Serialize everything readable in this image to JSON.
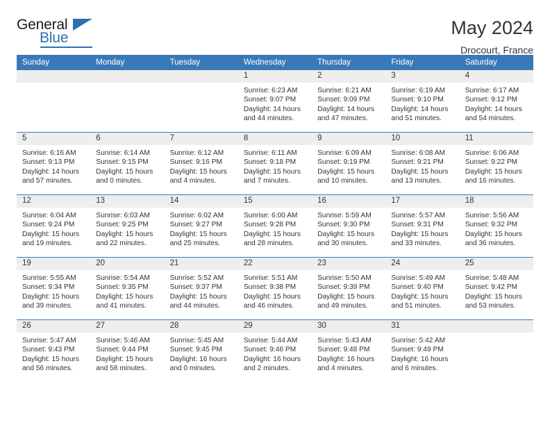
{
  "logo": {
    "word_one": "General",
    "word_two": "Blue",
    "triangle_icon": "triangle-icon"
  },
  "header": {
    "title": "May 2024",
    "location": "Drocourt, France"
  },
  "colors": {
    "header_blue": "#3a79b8",
    "logo_blue": "#2b6fb3",
    "day_band": "#eeeeee",
    "text": "#333333"
  },
  "weekday_headers": [
    "Sunday",
    "Monday",
    "Tuesday",
    "Wednesday",
    "Thursday",
    "Friday",
    "Saturday"
  ],
  "labels": {
    "sunrise": "Sunrise:",
    "sunset": "Sunset:",
    "daylight": "Daylight:"
  },
  "weeks": [
    [
      {
        "day": "",
        "empty": true
      },
      {
        "day": "",
        "empty": true
      },
      {
        "day": "",
        "empty": true
      },
      {
        "day": "1",
        "sunrise": "Sunrise: 6:23 AM",
        "sunset": "Sunset: 9:07 PM",
        "daylight_line1": "Daylight: 14 hours",
        "daylight_line2": "and 44 minutes."
      },
      {
        "day": "2",
        "sunrise": "Sunrise: 6:21 AM",
        "sunset": "Sunset: 9:09 PM",
        "daylight_line1": "Daylight: 14 hours",
        "daylight_line2": "and 47 minutes."
      },
      {
        "day": "3",
        "sunrise": "Sunrise: 6:19 AM",
        "sunset": "Sunset: 9:10 PM",
        "daylight_line1": "Daylight: 14 hours",
        "daylight_line2": "and 51 minutes."
      },
      {
        "day": "4",
        "sunrise": "Sunrise: 6:17 AM",
        "sunset": "Sunset: 9:12 PM",
        "daylight_line1": "Daylight: 14 hours",
        "daylight_line2": "and 54 minutes."
      }
    ],
    [
      {
        "day": "5",
        "sunrise": "Sunrise: 6:16 AM",
        "sunset": "Sunset: 9:13 PM",
        "daylight_line1": "Daylight: 14 hours",
        "daylight_line2": "and 57 minutes."
      },
      {
        "day": "6",
        "sunrise": "Sunrise: 6:14 AM",
        "sunset": "Sunset: 9:15 PM",
        "daylight_line1": "Daylight: 15 hours",
        "daylight_line2": "and 0 minutes."
      },
      {
        "day": "7",
        "sunrise": "Sunrise: 6:12 AM",
        "sunset": "Sunset: 9:16 PM",
        "daylight_line1": "Daylight: 15 hours",
        "daylight_line2": "and 4 minutes."
      },
      {
        "day": "8",
        "sunrise": "Sunrise: 6:11 AM",
        "sunset": "Sunset: 9:18 PM",
        "daylight_line1": "Daylight: 15 hours",
        "daylight_line2": "and 7 minutes."
      },
      {
        "day": "9",
        "sunrise": "Sunrise: 6:09 AM",
        "sunset": "Sunset: 9:19 PM",
        "daylight_line1": "Daylight: 15 hours",
        "daylight_line2": "and 10 minutes."
      },
      {
        "day": "10",
        "sunrise": "Sunrise: 6:08 AM",
        "sunset": "Sunset: 9:21 PM",
        "daylight_line1": "Daylight: 15 hours",
        "daylight_line2": "and 13 minutes."
      },
      {
        "day": "11",
        "sunrise": "Sunrise: 6:06 AM",
        "sunset": "Sunset: 9:22 PM",
        "daylight_line1": "Daylight: 15 hours",
        "daylight_line2": "and 16 minutes."
      }
    ],
    [
      {
        "day": "12",
        "sunrise": "Sunrise: 6:04 AM",
        "sunset": "Sunset: 9:24 PM",
        "daylight_line1": "Daylight: 15 hours",
        "daylight_line2": "and 19 minutes."
      },
      {
        "day": "13",
        "sunrise": "Sunrise: 6:03 AM",
        "sunset": "Sunset: 9:25 PM",
        "daylight_line1": "Daylight: 15 hours",
        "daylight_line2": "and 22 minutes."
      },
      {
        "day": "14",
        "sunrise": "Sunrise: 6:02 AM",
        "sunset": "Sunset: 9:27 PM",
        "daylight_line1": "Daylight: 15 hours",
        "daylight_line2": "and 25 minutes."
      },
      {
        "day": "15",
        "sunrise": "Sunrise: 6:00 AM",
        "sunset": "Sunset: 9:28 PM",
        "daylight_line1": "Daylight: 15 hours",
        "daylight_line2": "and 28 minutes."
      },
      {
        "day": "16",
        "sunrise": "Sunrise: 5:59 AM",
        "sunset": "Sunset: 9:30 PM",
        "daylight_line1": "Daylight: 15 hours",
        "daylight_line2": "and 30 minutes."
      },
      {
        "day": "17",
        "sunrise": "Sunrise: 5:57 AM",
        "sunset": "Sunset: 9:31 PM",
        "daylight_line1": "Daylight: 15 hours",
        "daylight_line2": "and 33 minutes."
      },
      {
        "day": "18",
        "sunrise": "Sunrise: 5:56 AM",
        "sunset": "Sunset: 9:32 PM",
        "daylight_line1": "Daylight: 15 hours",
        "daylight_line2": "and 36 minutes."
      }
    ],
    [
      {
        "day": "19",
        "sunrise": "Sunrise: 5:55 AM",
        "sunset": "Sunset: 9:34 PM",
        "daylight_line1": "Daylight: 15 hours",
        "daylight_line2": "and 39 minutes."
      },
      {
        "day": "20",
        "sunrise": "Sunrise: 5:54 AM",
        "sunset": "Sunset: 9:35 PM",
        "daylight_line1": "Daylight: 15 hours",
        "daylight_line2": "and 41 minutes."
      },
      {
        "day": "21",
        "sunrise": "Sunrise: 5:52 AM",
        "sunset": "Sunset: 9:37 PM",
        "daylight_line1": "Daylight: 15 hours",
        "daylight_line2": "and 44 minutes."
      },
      {
        "day": "22",
        "sunrise": "Sunrise: 5:51 AM",
        "sunset": "Sunset: 9:38 PM",
        "daylight_line1": "Daylight: 15 hours",
        "daylight_line2": "and 46 minutes."
      },
      {
        "day": "23",
        "sunrise": "Sunrise: 5:50 AM",
        "sunset": "Sunset: 9:39 PM",
        "daylight_line1": "Daylight: 15 hours",
        "daylight_line2": "and 49 minutes."
      },
      {
        "day": "24",
        "sunrise": "Sunrise: 5:49 AM",
        "sunset": "Sunset: 9:40 PM",
        "daylight_line1": "Daylight: 15 hours",
        "daylight_line2": "and 51 minutes."
      },
      {
        "day": "25",
        "sunrise": "Sunrise: 5:48 AM",
        "sunset": "Sunset: 9:42 PM",
        "daylight_line1": "Daylight: 15 hours",
        "daylight_line2": "and 53 minutes."
      }
    ],
    [
      {
        "day": "26",
        "sunrise": "Sunrise: 5:47 AM",
        "sunset": "Sunset: 9:43 PM",
        "daylight_line1": "Daylight: 15 hours",
        "daylight_line2": "and 56 minutes."
      },
      {
        "day": "27",
        "sunrise": "Sunrise: 5:46 AM",
        "sunset": "Sunset: 9:44 PM",
        "daylight_line1": "Daylight: 15 hours",
        "daylight_line2": "and 58 minutes."
      },
      {
        "day": "28",
        "sunrise": "Sunrise: 5:45 AM",
        "sunset": "Sunset: 9:45 PM",
        "daylight_line1": "Daylight: 16 hours",
        "daylight_line2": "and 0 minutes."
      },
      {
        "day": "29",
        "sunrise": "Sunrise: 5:44 AM",
        "sunset": "Sunset: 9:46 PM",
        "daylight_line1": "Daylight: 16 hours",
        "daylight_line2": "and 2 minutes."
      },
      {
        "day": "30",
        "sunrise": "Sunrise: 5:43 AM",
        "sunset": "Sunset: 9:48 PM",
        "daylight_line1": "Daylight: 16 hours",
        "daylight_line2": "and 4 minutes."
      },
      {
        "day": "31",
        "sunrise": "Sunrise: 5:42 AM",
        "sunset": "Sunset: 9:49 PM",
        "daylight_line1": "Daylight: 16 hours",
        "daylight_line2": "and 6 minutes."
      },
      {
        "day": "",
        "empty": true
      }
    ]
  ]
}
